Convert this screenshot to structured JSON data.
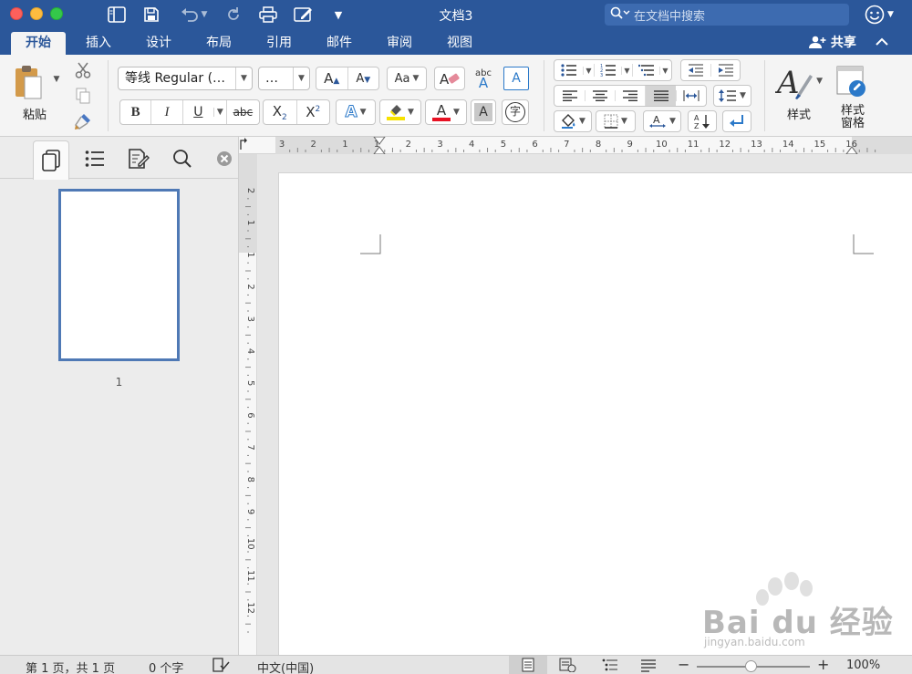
{
  "window": {
    "title": "文档3",
    "search_placeholder": "在文档中搜索"
  },
  "tabs": [
    {
      "label": "开始",
      "active": true
    },
    {
      "label": "插入"
    },
    {
      "label": "设计"
    },
    {
      "label": "布局"
    },
    {
      "label": "引用"
    },
    {
      "label": "邮件"
    },
    {
      "label": "审阅"
    },
    {
      "label": "视图"
    }
  ],
  "share_label": "共享",
  "ribbon": {
    "paste_label": "粘贴",
    "font_name": "等线 Regular (…",
    "font_size": "…",
    "grow_font": "A",
    "shrink_font": "A",
    "change_case": "Aa",
    "phonetic_top": "abc",
    "phonetic_bottom": "A",
    "border_char": "A",
    "bold": "B",
    "italic": "I",
    "underline": "U",
    "strikethrough": "abc",
    "subscript_base": "X",
    "subscript_index": "2",
    "superscript_base": "X",
    "superscript_index": "2",
    "text_effects": "A",
    "font_color_letter": "A",
    "char_shading": "A",
    "enclose_char": "字",
    "styles_label": "样式",
    "styles_pane_label_1": "样式",
    "styles_pane_label_2": "窗格",
    "colors": {
      "highlight": "#f7e200",
      "font_color": "#e81123",
      "accent": "#2b579a"
    }
  },
  "nav": {
    "page_number": "1"
  },
  "ruler": {
    "h_labels": [
      "3",
      "2",
      "1",
      "1",
      "2",
      "3",
      "4",
      "5",
      "6",
      "7",
      "8",
      "9",
      "10",
      "11",
      "12",
      "13",
      "14",
      "15",
      "16"
    ],
    "v_labels": [
      "2",
      "1",
      "1",
      "2",
      "3",
      "4",
      "5",
      "6",
      "7",
      "8",
      "9",
      "10",
      "11",
      "12"
    ]
  },
  "status": {
    "page_info": "第 1 页，共 1 页",
    "word_count": "0 个字",
    "language": "中文(中国)",
    "zoom_minus": "−",
    "zoom_plus": "+",
    "zoom": "100%"
  },
  "watermark": {
    "brand": "Bai du 经验",
    "url": "jingyan.baidu.com"
  }
}
